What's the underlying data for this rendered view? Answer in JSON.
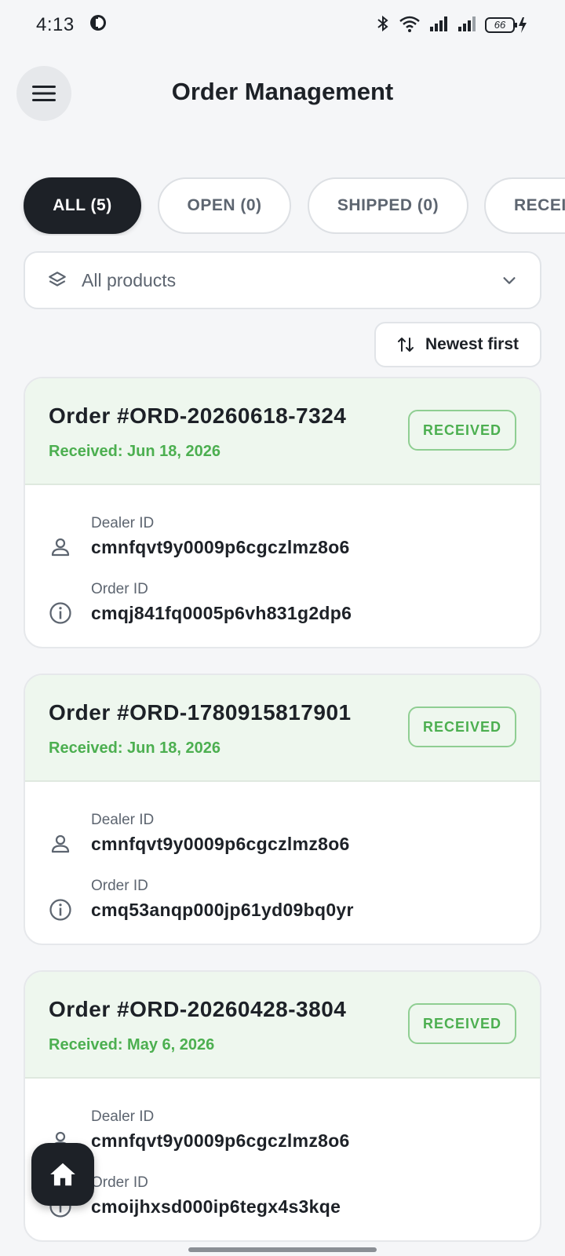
{
  "status_bar": {
    "time": "4:13",
    "battery": "66"
  },
  "header": {
    "title": "Order Management"
  },
  "tabs": [
    {
      "label": "ALL (5)",
      "active": true
    },
    {
      "label": "OPEN (0)",
      "active": false
    },
    {
      "label": "SHIPPED (0)",
      "active": false
    },
    {
      "label": "RECEIVED",
      "active": false
    }
  ],
  "filter": {
    "label": "All products"
  },
  "sort": {
    "label": "Newest first"
  },
  "orders": [
    {
      "title": "Order #ORD-20260618-7324",
      "date": "Received: Jun 18, 2026",
      "status": "RECEIVED",
      "dealer_label": "Dealer ID",
      "dealer_id": "cmnfqvt9y0009p6cgczlmz8o6",
      "order_label": "Order ID",
      "order_id": "cmqj841fq0005p6vh831g2dp6"
    },
    {
      "title": "Order #ORD-1780915817901",
      "date": "Received: Jun 18, 2026",
      "status": "RECEIVED",
      "dealer_label": "Dealer ID",
      "dealer_id": "cmnfqvt9y0009p6cgczlmz8o6",
      "order_label": "Order ID",
      "order_id": "cmq53anqp000jp61yd09bq0yr"
    },
    {
      "title": "Order #ORD-20260428-3804",
      "date": "Received: May 6, 2026",
      "status": "RECEIVED",
      "dealer_label": "Dealer ID",
      "dealer_id": "cmnfqvt9y0009p6cgczlmz8o6",
      "order_label": "Order ID",
      "order_id": "cmoijhxsd000ip6tegx4s3kqe"
    }
  ],
  "colors": {
    "accent": "#1d2127",
    "success": "#4caf50",
    "success_bg": "#eef7ee"
  }
}
